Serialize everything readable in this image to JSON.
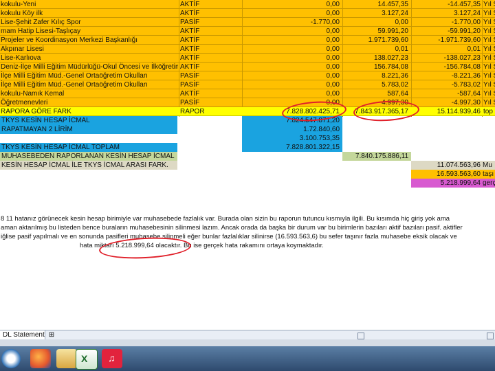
{
  "rows": [
    {
      "name": "kokulu-Yeni",
      "status": "AKTİF",
      "v1": "0,00",
      "v2": "14.457,35",
      "v3": "-14.457,35",
      "v4": "Yıl S"
    },
    {
      "name": "kokulu Köy ilk",
      "status": "AKTİF",
      "v1": "0,00",
      "v2": "3.127,24",
      "v3": "3.127,24",
      "v4": "Yıl S"
    },
    {
      "name": "Lise-Şehit Zafer Kılıç Spor",
      "status": "PASİF",
      "v1": "-1.770,00",
      "v2": "0,00",
      "v3": "-1.770,00",
      "v4": "Yıl S"
    },
    {
      "name": "mam Hatip Lisesi-Taşlıçay",
      "status": "AKTİF",
      "v1": "0,00",
      "v2": "59.991,20",
      "v3": "-59.991,20",
      "v4": "Yıl S"
    },
    {
      "name": "Projeler ve Koordinasyon Merkezi Başkanlığı",
      "status": "AKTİF",
      "v1": "0,00",
      "v2": "1.971.739,60",
      "v3": "-1.971.739,60",
      "v4": "Yıl S"
    },
    {
      "name": "Akpınar Lisesi",
      "status": "AKTİF",
      "v1": "0,00",
      "v2": "0,01",
      "v3": "0,01",
      "v4": "Yıl S"
    },
    {
      "name": "Lise-Karlıova",
      "status": "AKTİF",
      "v1": "0,00",
      "v2": "138.027,23",
      "v3": "-138.027,23",
      "v4": "Yıl S"
    },
    {
      "name": "Deniz-İlçe Milli Eğitim Müdürlüğü-Okul Öncesi ve İlköğretim",
      "status": "AKTİF",
      "v1": "0,00",
      "v2": "156.784,08",
      "v3": "-156.784,08",
      "v4": "Yıl S"
    },
    {
      "name": "İlçe Milli Eğitim Müd.-Genel Ortaöğretim Okulları",
      "status": "PASİF",
      "v1": "0,00",
      "v2": "8.221,36",
      "v3": "-8.221,36",
      "v4": "Yıl S"
    },
    {
      "name": "İlçe Milli Eğitim Müd.-Genel Ortaöğretim Okulları",
      "status": "PASİF",
      "v1": "0,00",
      "v2": "5.783,02",
      "v3": "-5.783,02",
      "v4": "Yıl S"
    },
    {
      "name": "kokulu-Namık Kemal",
      "status": "AKTİF",
      "v1": "0,00",
      "v2": "587,64",
      "v3": "-587,64",
      "v4": "Yıl S"
    },
    {
      "name": "Öğretmenevleri",
      "status": "PASİF",
      "v1": "0,00",
      "v2": "4.997,30",
      "v3": "-4.997,30",
      "v4": "Yıl S"
    }
  ],
  "rapor": {
    "name": "RAPORA GÖRE FARK",
    "status": "RAPOR",
    "v1": "7.828.802.425,71",
    "v2": "7.843.917.365,17",
    "v3": "15.114.939,46",
    "v4": "top"
  },
  "summary": {
    "r1_label": "TKYS KESİN HESAP İCMAL",
    "r1_v": "7.824.547.871,20",
    "r2_label": "RAPATMAYAN 2 LİRİM",
    "r2_v": "1.72.840,60",
    "r3_v": "3.100.753,35",
    "total_label": "TKYS KESİN HESAP İCMAL TOPLAM",
    "total_v": "7.828.801.322,15",
    "muh_label": "MUHASEBEDEN RAPORLANAN KESİN HESAP İCMAL",
    "muh_v": "7.840.175.886,11",
    "diff_label": "KESİN HESAP İCMAL İLE TKYS İCMAL ARASI FARK.",
    "right1_v": "11.074.563,96",
    "right1_t": "Mu",
    "right2_v": "16.593.563,60",
    "right2_t": "taşı",
    "right3_v": "5.218.999,64",
    "right3_t": "gerç"
  },
  "note": {
    "line1": "8 11 hatanız görünecek kesin hesap birimiyle var muhasebede fazlalık var. Burada olan sizin bu raporun tutuncu kısmıyla ilgili. Bu kısımda hiç giriş yok ama",
    "line2": "aman aktarılmış bu listeden bence buraların muhasebesinin silinmesi lazım. Ancak orada da başka bir durum var bu birimlerin bazıları aktif bazıları pasif. aktifler",
    "line3": "iğlise pasif yapılmalı ve en sonunda pasifleri muhasebe silinmeli eğer bunlar fazlalıklar silinirse (16.593.563,6) bu sefer taşınır fazla muhasebe eksik olacak ve",
    "line4": "hata miktarı 5.218.999,64 olacaktır. Bu ise gerçek hata rakamını ortaya koymaktadır."
  },
  "tabs": {
    "sheet_label": "DL Statement"
  },
  "colors": {
    "orange": "#ffc000",
    "yellow": "#ffff00",
    "blue": "#1aa3e0",
    "green": "#c4d79b",
    "magenta": "#d85ad0",
    "highlight": "#e0202a"
  },
  "taskbar_icons": [
    "firefox-icon",
    "outlook-icon",
    "excel-icon",
    "itunes-icon"
  ]
}
